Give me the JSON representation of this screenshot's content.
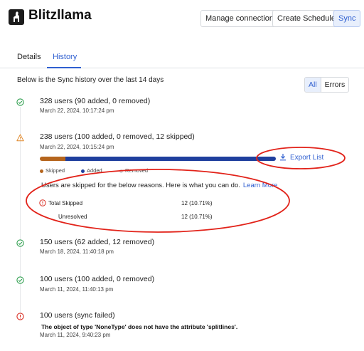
{
  "app": {
    "title": "Blitzllama"
  },
  "header": {
    "manage_label": "Manage connection",
    "create_label": "Create Schedule",
    "sync_label": "Sync"
  },
  "tabs": [
    {
      "label": "Details",
      "active": false
    },
    {
      "label": "History",
      "active": true
    }
  ],
  "history": {
    "intro": "Below is the Sync history over the last 14 days",
    "filters": [
      {
        "label": "All",
        "selected": true
      },
      {
        "label": "Errors",
        "selected": false
      }
    ],
    "entries": [
      {
        "status": "success",
        "title": "328 users (90 added, 0 removed)",
        "date": "March 22, 2024, 10:17:24 pm"
      },
      {
        "status": "warning",
        "title": "238 users (100 added, 0 removed, 12 skipped)",
        "date": "March 22, 2024, 10:15:24 pm",
        "progress": {
          "skipped": 12,
          "added": 100,
          "removed": 0
        },
        "legend": [
          "Skipped",
          "Added",
          "Removed"
        ],
        "export_label": "Export List",
        "reasons_text": "Users are skipped for the below reasons. Here is what you can do.",
        "learn_more": "Learn More",
        "skipped_rows": [
          {
            "label": "Total Skipped",
            "value": "12 (10.71%)"
          },
          {
            "label": "Unresolved",
            "value": "12 (10.71%)"
          }
        ]
      },
      {
        "status": "success",
        "title": "150 users (62 added, 12 removed)",
        "date": "March 18, 2024, 11:40:18 pm"
      },
      {
        "status": "success",
        "title": "100 users (100 added, 0 removed)",
        "date": "March 11, 2024, 11:40:13 pm"
      },
      {
        "status": "error",
        "title": "100 users (sync failed)",
        "error": "The object of type 'NoneType' does not have the attribute 'splitlines'.",
        "date": "March 11, 2024, 9:40:23 pm"
      }
    ]
  },
  "colors": {
    "accent": "#2f5fd0",
    "success": "#2e9e4e",
    "warning": "#e08a2e",
    "error": "#d93025",
    "skipped": "#b5651d",
    "added": "#1f3f9e",
    "removed": "#d0d3d8",
    "annotation": "#e2231a"
  }
}
